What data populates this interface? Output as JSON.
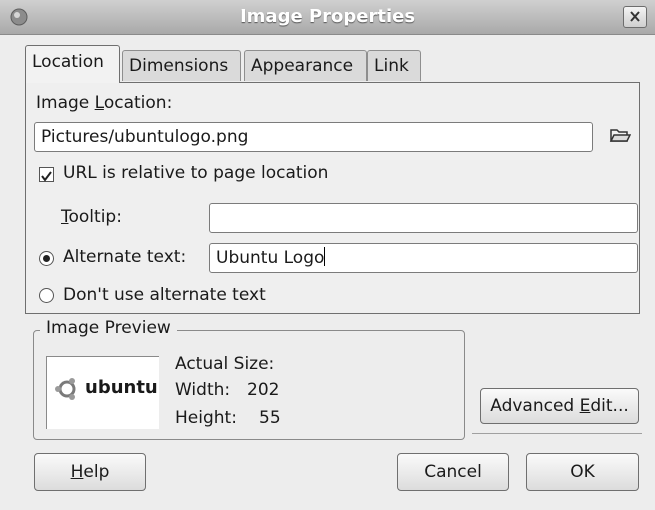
{
  "window": {
    "title": "Image Properties"
  },
  "tabs": [
    {
      "label": "Location",
      "active": true
    },
    {
      "label": "Dimensions",
      "active": false
    },
    {
      "label": "Appearance",
      "active": false
    },
    {
      "label": "Link",
      "active": false
    }
  ],
  "location": {
    "image_location_label_pre": "Image ",
    "image_location_label_u": "L",
    "image_location_label_post": "ocation:",
    "image_location_value": "Pictures/ubuntulogo.png",
    "relative_url_label": "URL is relative to page location",
    "relative_url_checked": true,
    "tooltip_label_u": "T",
    "tooltip_label_post": "ooltip:",
    "tooltip_value": "",
    "alt_text_label": "Alternate text:",
    "alt_text_value": "Ubuntu Logo",
    "alt_text_selected": true,
    "no_alt_text_label": "Don't use alternate text",
    "no_alt_text_selected": false
  },
  "preview": {
    "frame_title": "Image Preview",
    "logo_text": "ubuntu",
    "actual_size_label": "Actual Size:",
    "width_label": "Width:",
    "width_value": "202",
    "height_label": "Height:",
    "height_value": "55"
  },
  "buttons": {
    "advanced_edit_pre": "Advanced ",
    "advanced_edit_u": "E",
    "advanced_edit_post": "dit...",
    "help_u": "H",
    "help_post": "elp",
    "cancel": "Cancel",
    "ok": "OK"
  },
  "icons": {
    "window": "app-icon",
    "close": "close-icon",
    "browse": "folder-open-icon",
    "logo": "ubuntu-logo"
  }
}
